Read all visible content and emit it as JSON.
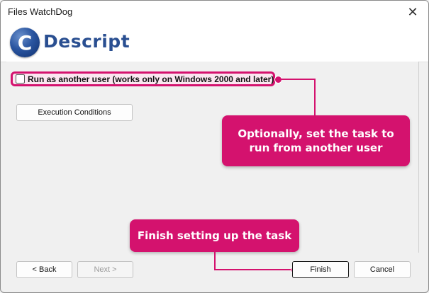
{
  "window": {
    "title": "Files WatchDog",
    "close_glyph": "✕"
  },
  "banner": {
    "logo_letter": "C",
    "logo_text": "Descript"
  },
  "options": {
    "run_as_label": "Run as another user  (works only on Windows 2000 and later)",
    "run_as_checked": false,
    "execution_conditions_label": "Execution Conditions"
  },
  "footer": {
    "back_label": "<  Back",
    "next_label": "Next  >",
    "finish_label": "Finish",
    "cancel_label": "Cancel"
  },
  "callouts": {
    "run_as_hint": "Optionally, set the task to run from another user",
    "finish_hint": "Finish setting up the task"
  },
  "colors": {
    "accent": "#d4126e",
    "logo_blue": "#2a4f91"
  },
  "icons": {
    "close": "close-icon",
    "logo": "descript-logo-icon"
  }
}
